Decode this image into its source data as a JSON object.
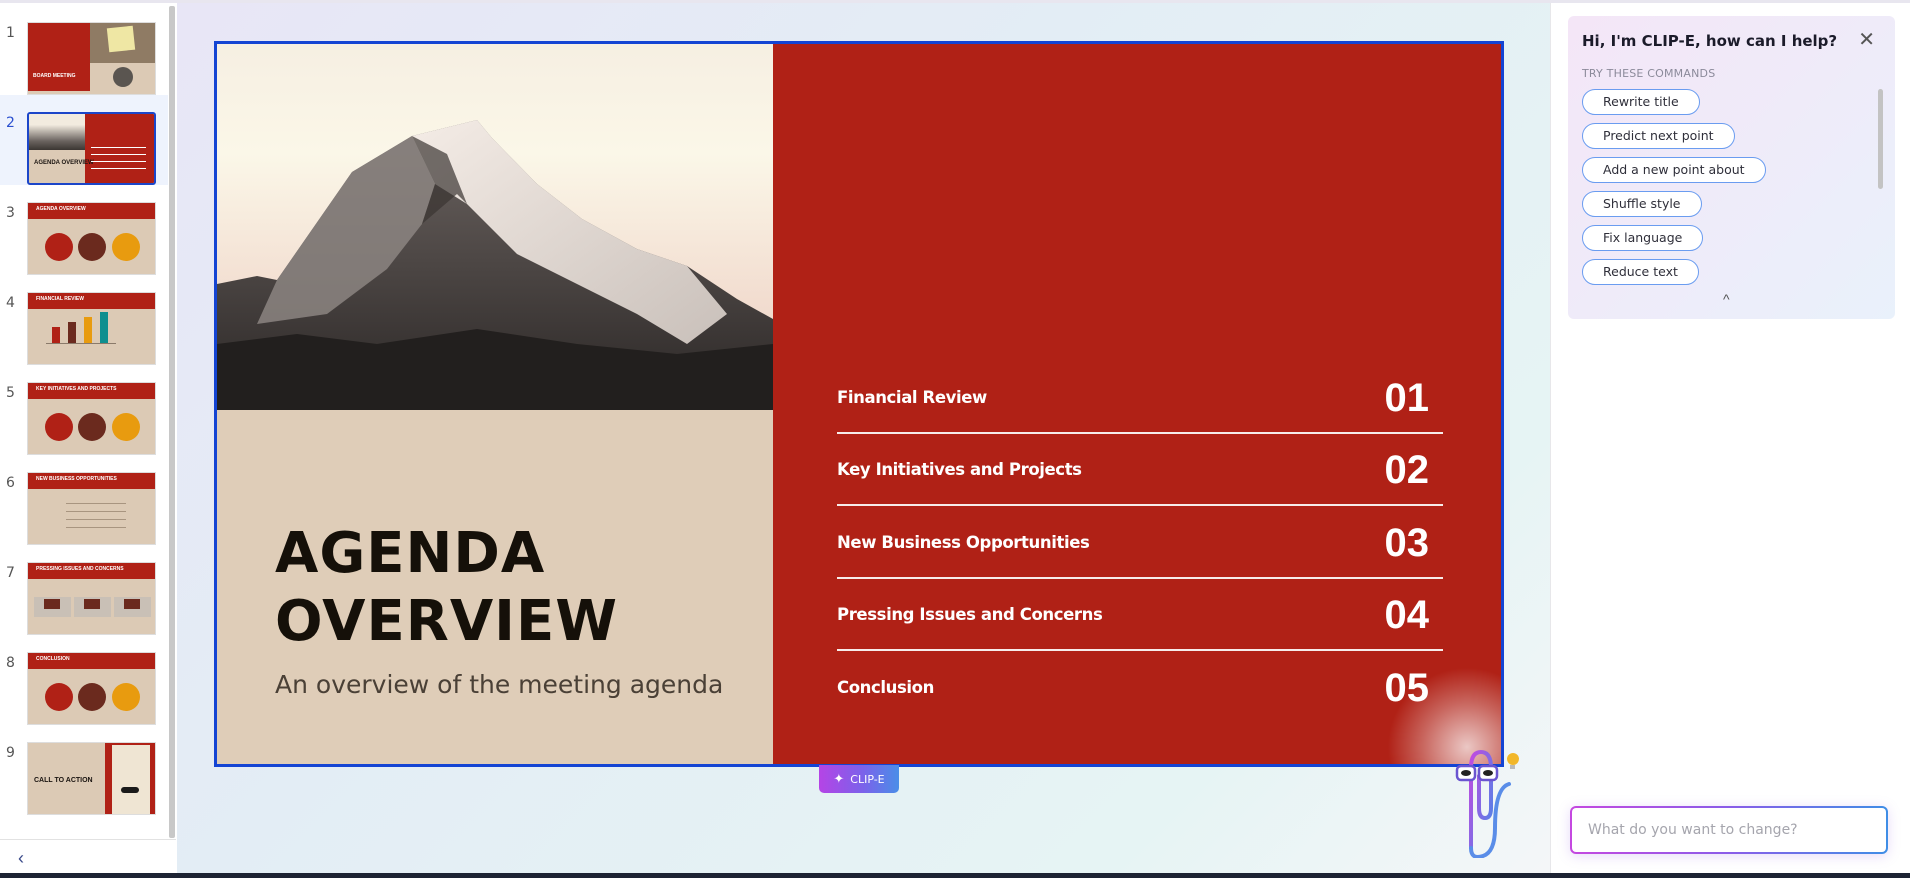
{
  "sidebar": {
    "active_slide": 2,
    "slides": [
      {
        "number": "1",
        "title": "BOARD MEETING"
      },
      {
        "number": "2",
        "title": "AGENDA OVERVIEW"
      },
      {
        "number": "3",
        "title": "AGENDA OVERVIEW"
      },
      {
        "number": "4",
        "title": "FINANCIAL REVIEW"
      },
      {
        "number": "5",
        "title": "KEY INITIATIVES AND PROJECTS"
      },
      {
        "number": "6",
        "title": "NEW BUSINESS OPPORTUNITIES"
      },
      {
        "number": "7",
        "title": "PRESSING ISSUES AND CONCERNS"
      },
      {
        "number": "8",
        "title": "CONCLUSION"
      },
      {
        "number": "9",
        "title": "CALL TO ACTION"
      }
    ],
    "collapse_icon": "chevron-left-icon",
    "collapse_glyph": "‹"
  },
  "slide": {
    "title_line1": "AGENDA",
    "title_line2": "OVERVIEW",
    "subtitle": "An overview of the meeting agenda",
    "image": "snow-capped mountain peak",
    "colors": {
      "accent_red": "#b02116",
      "beige": "#dfccb7",
      "dark_text": "#151009",
      "selection_border": "#1444d3"
    },
    "agenda": [
      {
        "label": "Financial Review",
        "number": "01"
      },
      {
        "label": "Key Initiatives and Projects",
        "number": "02"
      },
      {
        "label": "New Business Opportunities",
        "number": "03"
      },
      {
        "label": "Pressing Issues and Concerns",
        "number": "04"
      },
      {
        "label": "Conclusion",
        "number": "05"
      }
    ]
  },
  "canvas": {
    "clipe_button_label": "CLIP-E",
    "clipe_button_icon": "magic-sparkle-icon",
    "mascot": "paperclip-mascot-with-glasses-and-lightbulb"
  },
  "assistant": {
    "title": "Hi, I'm CLIP-E, how can I help?",
    "close_glyph": "✕",
    "commands_header": "TRY THESE COMMANDS",
    "commands": [
      "Rewrite title",
      "Predict next point",
      "Add a new point about",
      "Shuffle style",
      "Fix language",
      "Reduce text"
    ],
    "collapse_glyph": "^",
    "input_placeholder": "What do you want to change?",
    "input_value": ""
  }
}
